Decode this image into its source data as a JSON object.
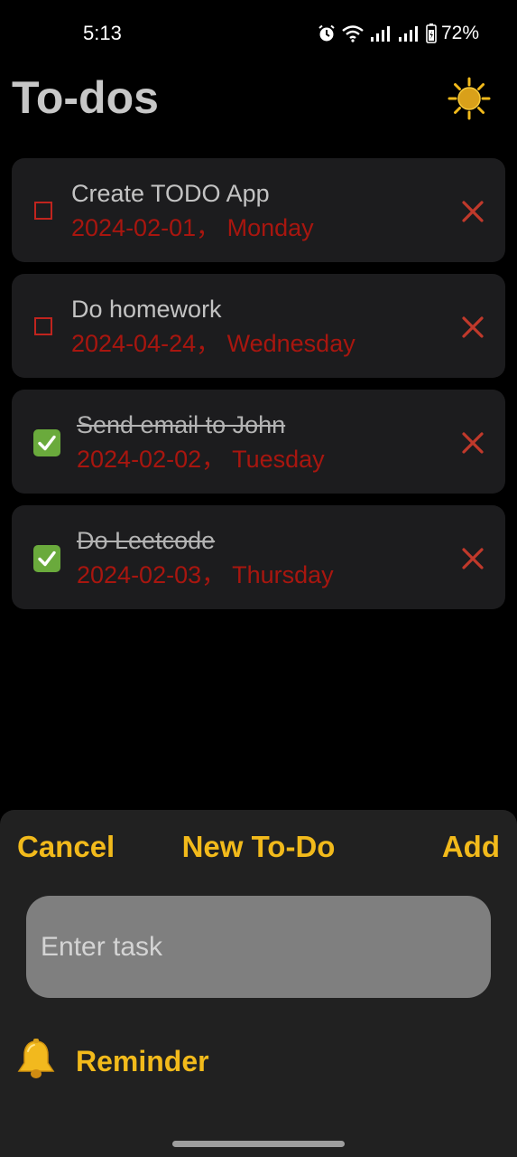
{
  "status_bar": {
    "time": "5:13",
    "battery": "72%",
    "icons": [
      "alarm-icon",
      "wifi-icon",
      "signal-icon",
      "signal-icon",
      "battery-icon"
    ]
  },
  "header": {
    "title": "To-dos",
    "theme_icon": "sun-icon"
  },
  "todos": [
    {
      "title": "Create TODO App",
      "date": "2024-02-01， Monday",
      "done": false
    },
    {
      "title": "Do homework",
      "date": "2024-04-24， Wednesday",
      "done": false
    },
    {
      "title": "Send email to John",
      "date": "2024-02-02， Tuesday",
      "done": true
    },
    {
      "title": "Do Leetcode",
      "date": "2024-02-03， Thursday",
      "done": true
    }
  ],
  "sheet": {
    "cancel_label": "Cancel",
    "title": "New To-Do",
    "add_label": "Add",
    "task_input": {
      "placeholder": "Enter task",
      "value": ""
    },
    "reminder_label": "Reminder",
    "reminder_icon": "bell-icon"
  },
  "colors": {
    "background": "#000000",
    "card": "#1c1c1e",
    "sheet": "#212121",
    "accent": "#f2ba1b",
    "date_red": "#a8160f",
    "delete_red": "#c0392b",
    "check_green": "#6aaa3c"
  }
}
